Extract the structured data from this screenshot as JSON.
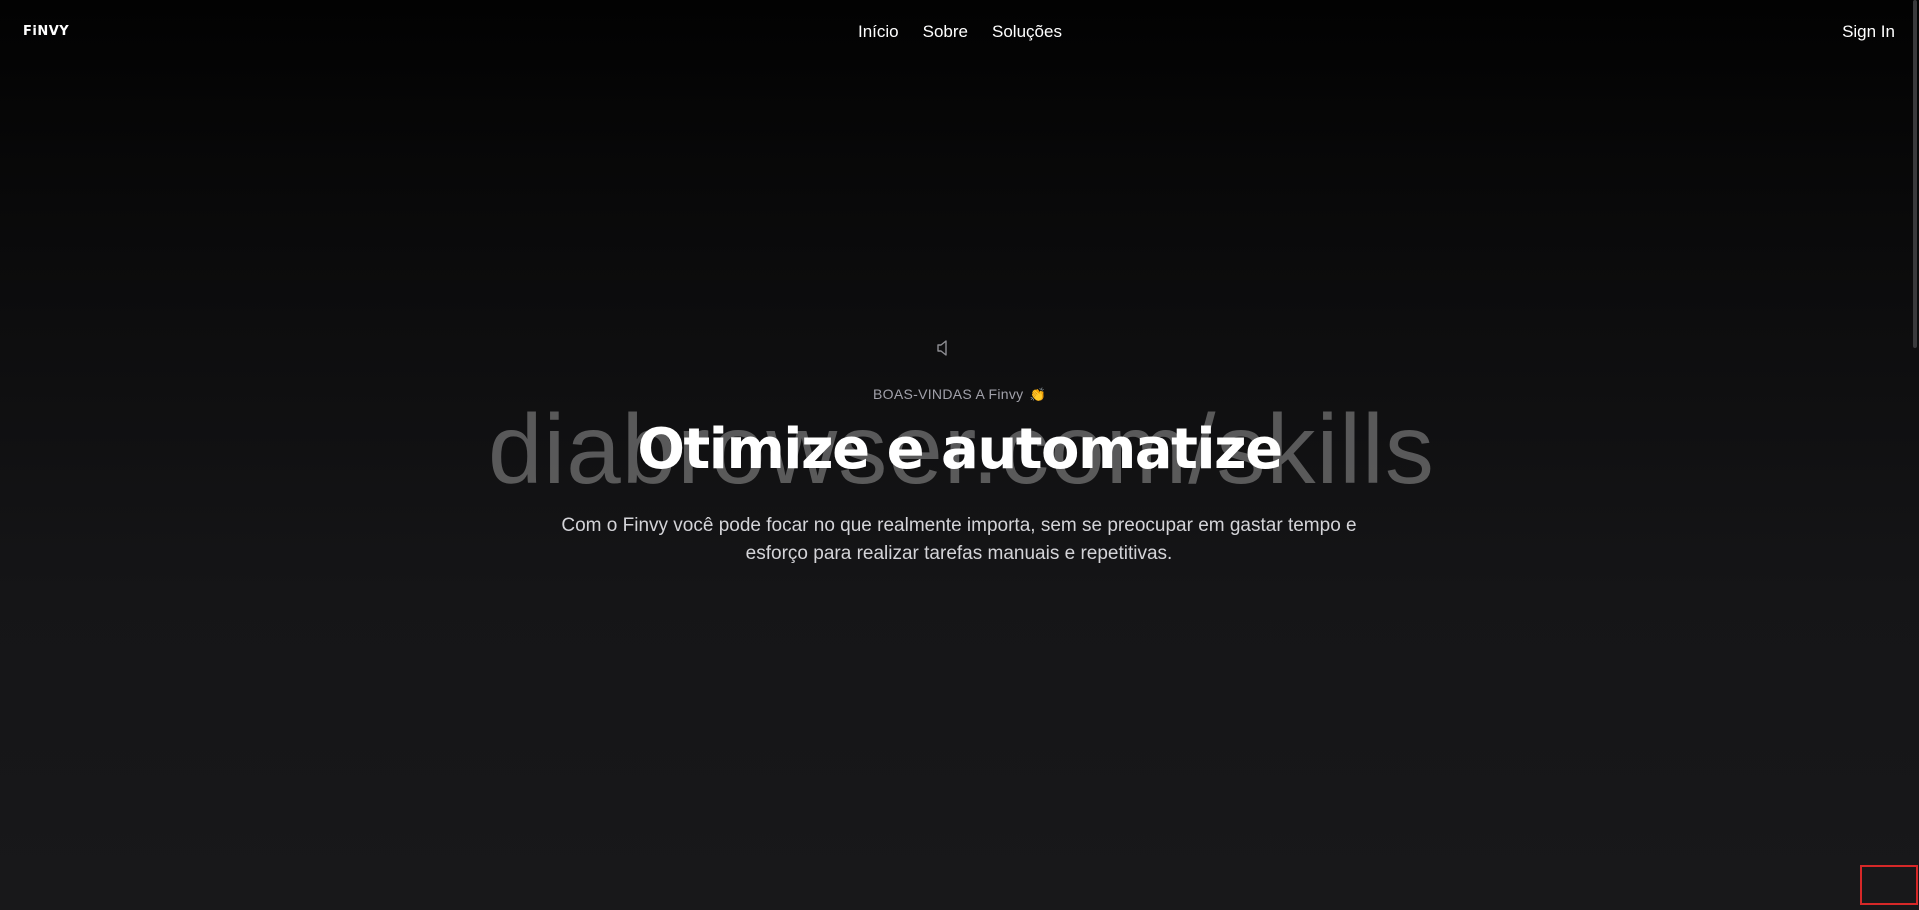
{
  "header": {
    "logo": "FiNVY",
    "nav": [
      {
        "label": "Início"
      },
      {
        "label": "Sobre"
      },
      {
        "label": "Soluções"
      }
    ],
    "signin_label": "Sign In"
  },
  "hero": {
    "welcome": "BOAS-VINDAS A Finvy",
    "welcome_emoji": "👏",
    "watermark": "diabrowser.com/skills",
    "headline": "Otimize e automatize",
    "subtitle": "Com o Finvy você pode focar no que realmente importa, sem se preocupar em gastar tempo e esforço para realizar tarefas manuais e repetitivas."
  },
  "icons": {
    "speaker": "speaker-icon"
  },
  "colors": {
    "background_top": "#020202",
    "background_bottom": "#18181a",
    "text_primary": "#ffffff",
    "text_muted": "#a1a1aa",
    "subtitle": "#d4d4d8",
    "highlight_box": "#d62828"
  }
}
